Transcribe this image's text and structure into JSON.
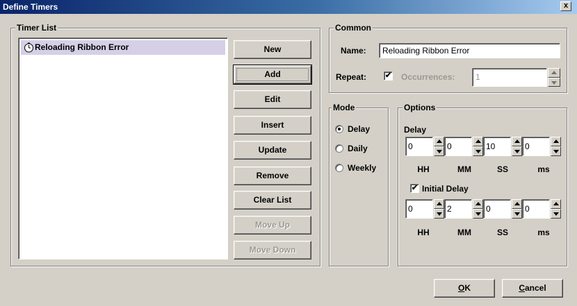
{
  "window": {
    "title": "Define Timers",
    "close_glyph": "x"
  },
  "timer_list": {
    "legend": "Timer List",
    "items": [
      {
        "label": "Reloading Ribbon Error",
        "icon": "clock-icon",
        "selected": true
      }
    ]
  },
  "buttons": {
    "new": "New",
    "add": "Add",
    "edit": "Edit",
    "insert": "Insert",
    "update": "Update",
    "remove": "Remove",
    "clear_list": "Clear List",
    "move_up": "Move Up",
    "move_down": "Move Down",
    "ok": "OK",
    "cancel": "Cancel"
  },
  "common": {
    "legend": "Common",
    "name_label": "Name:",
    "name_value": "Reloading Ribbon Error",
    "repeat_label": "Repeat:",
    "repeat_checked": true,
    "occurrences_label": "Occurrences:",
    "occurrences_value": "1"
  },
  "mode": {
    "legend": "Mode",
    "options": [
      {
        "label": "Delay",
        "checked": true
      },
      {
        "label": "Daily",
        "checked": false
      },
      {
        "label": "Weekly",
        "checked": false
      }
    ]
  },
  "options": {
    "legend": "Options",
    "delay_label": "Delay",
    "delay": {
      "hh": "0",
      "mm": "0",
      "ss": "10",
      "ms": "0"
    },
    "initial_delay_label": "Initial Delay",
    "initial_delay_checked": true,
    "initial_delay": {
      "hh": "0",
      "mm": "2",
      "ss": "0",
      "ms": "0"
    },
    "units": {
      "hh": "HH",
      "mm": "MM",
      "ss": "SS",
      "ms": "ms"
    }
  },
  "colors": {
    "face": "#d4d0c8",
    "title_start": "#0a246a",
    "selection": "#d5d0e6",
    "disabled_text": "#9a9891"
  }
}
